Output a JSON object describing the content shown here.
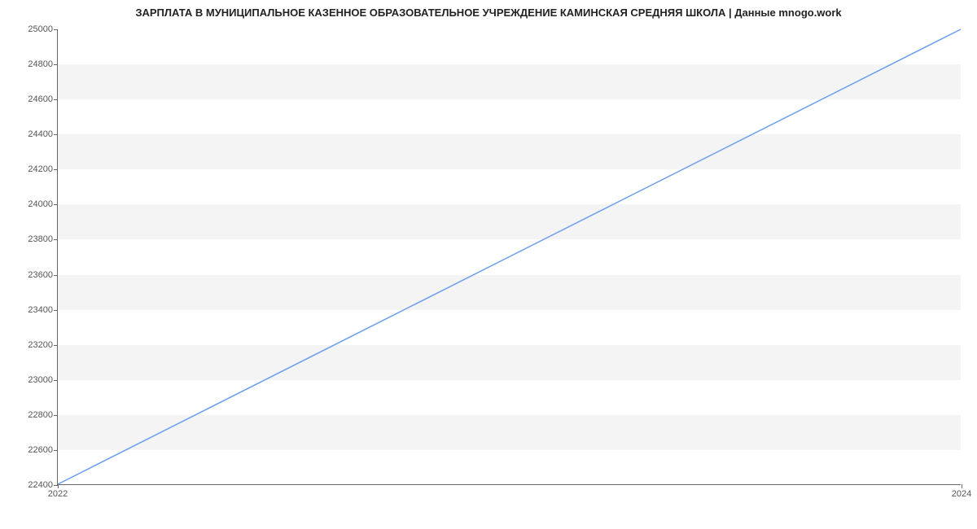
{
  "chart_data": {
    "type": "line",
    "title": "ЗАРПЛАТА В МУНИЦИПАЛЬНОЕ КАЗЕННОЕ ОБРАЗОВАТЕЛЬНОЕ УЧРЕЖДЕНИЕ КАМИНСКАЯ СРЕДНЯЯ  ШКОЛА | Данные mnogo.work",
    "xlabel": "",
    "ylabel": "",
    "x": [
      2022,
      2024
    ],
    "values": [
      22400,
      25000
    ],
    "x_ticks": [
      2022,
      2024
    ],
    "y_ticks": [
      22400,
      22600,
      22800,
      23000,
      23200,
      23400,
      23600,
      23800,
      24000,
      24200,
      24400,
      24600,
      24800,
      25000
    ],
    "xlim": [
      2022,
      2024
    ],
    "ylim": [
      22400,
      25000
    ],
    "line_color": "#6b9ef0"
  }
}
